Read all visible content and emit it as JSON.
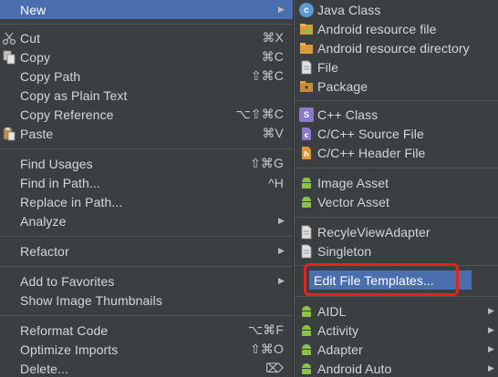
{
  "left_menu": {
    "items": [
      {
        "label": "New",
        "shortcut": "",
        "submenu": true,
        "icon": ""
      },
      {
        "label": "Cut",
        "shortcut": "⌘X",
        "submenu": false,
        "icon": "scissors-icon"
      },
      {
        "label": "Copy",
        "shortcut": "⌘C",
        "submenu": false,
        "icon": "copy-icon"
      },
      {
        "label": "Copy Path",
        "shortcut": "⇧⌘C",
        "submenu": false,
        "icon": ""
      },
      {
        "label": "Copy as Plain Text",
        "shortcut": "",
        "submenu": false,
        "icon": ""
      },
      {
        "label": "Copy Reference",
        "shortcut": "⌥⇧⌘C",
        "submenu": false,
        "icon": ""
      },
      {
        "label": "Paste",
        "shortcut": "⌘V",
        "submenu": false,
        "icon": "paste-icon"
      },
      {
        "label": "Find Usages",
        "shortcut": "⇧⌘G",
        "submenu": false,
        "icon": ""
      },
      {
        "label": "Find in Path...",
        "shortcut": "^H",
        "submenu": false,
        "icon": ""
      },
      {
        "label": "Replace in Path...",
        "shortcut": "",
        "submenu": false,
        "icon": ""
      },
      {
        "label": "Analyze",
        "shortcut": "",
        "submenu": true,
        "icon": ""
      },
      {
        "label": "Refactor",
        "shortcut": "",
        "submenu": true,
        "icon": ""
      },
      {
        "label": "Add to Favorites",
        "shortcut": "",
        "submenu": true,
        "icon": ""
      },
      {
        "label": "Show Image Thumbnails",
        "shortcut": "",
        "submenu": false,
        "icon": ""
      },
      {
        "label": "Reformat Code",
        "shortcut": "⌥⌘F",
        "submenu": false,
        "icon": ""
      },
      {
        "label": "Optimize Imports",
        "shortcut": "⇧⌘O",
        "submenu": false,
        "icon": ""
      },
      {
        "label": "Delete...",
        "shortcut": "⌦",
        "submenu": false,
        "icon": ""
      }
    ]
  },
  "right_menu": {
    "items": [
      {
        "label": "Java Class",
        "icon": "java-class-icon",
        "submenu": false
      },
      {
        "label": "Android resource file",
        "icon": "android-resource-file-icon",
        "submenu": false
      },
      {
        "label": "Android resource directory",
        "icon": "folder-icon",
        "submenu": false
      },
      {
        "label": "File",
        "icon": "file-icon",
        "submenu": false
      },
      {
        "label": "Package",
        "icon": "package-icon",
        "submenu": false
      },
      {
        "label": "C++ Class",
        "icon": "cpp-class-icon",
        "submenu": false
      },
      {
        "label": "C/C++ Source File",
        "icon": "cpp-source-icon",
        "submenu": false
      },
      {
        "label": "C/C++ Header File",
        "icon": "cpp-header-icon",
        "submenu": false
      },
      {
        "label": "Image Asset",
        "icon": "android-icon",
        "submenu": false
      },
      {
        "label": "Vector Asset",
        "icon": "android-icon",
        "submenu": false
      },
      {
        "label": "RecyleViewAdapter",
        "icon": "template-file-icon",
        "submenu": false
      },
      {
        "label": "Singleton",
        "icon": "template-file-icon",
        "submenu": false
      },
      {
        "label": "Edit File Templates...",
        "icon": "",
        "submenu": false
      },
      {
        "label": "AIDL",
        "icon": "android-icon",
        "submenu": true
      },
      {
        "label": "Activity",
        "icon": "android-icon",
        "submenu": true
      },
      {
        "label": "Adapter",
        "icon": "android-icon",
        "submenu": true
      },
      {
        "label": "Android Auto",
        "icon": "android-icon",
        "submenu": true
      }
    ]
  },
  "colors": {
    "menu_bg": "#3c3f41",
    "highlight": "#4b6eaf",
    "callout_border": "#e8201e",
    "text": "#d6d6d6"
  }
}
